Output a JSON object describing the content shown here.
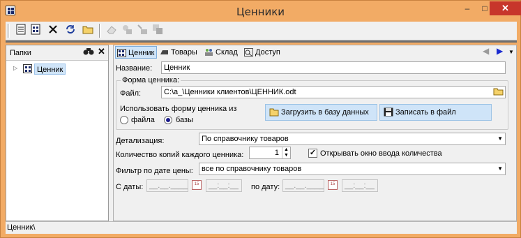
{
  "window": {
    "title": "Ценники",
    "minimize": "–",
    "maximize": "□",
    "close": "✕"
  },
  "toolbar": {
    "icons": [
      "doc-icon",
      "card-icon",
      "delete-icon",
      "refresh-icon",
      "folder-icon",
      "eraser-icon",
      "stamp-icon",
      "tools-icon",
      "copy-icon"
    ]
  },
  "left_panel": {
    "tab_label": "Папки",
    "tree": [
      {
        "label": "Ценник"
      }
    ]
  },
  "tabs": [
    {
      "label": "Ценник",
      "active": true
    },
    {
      "label": "Товары",
      "active": false
    },
    {
      "label": "Склад",
      "active": false
    },
    {
      "label": "Доступ",
      "active": false
    }
  ],
  "form": {
    "name_label": "Название:",
    "name_value": "Ценник",
    "group_title": "Форма ценника:",
    "file_label": "Файл:",
    "file_value": "C:\\a_\\Ценники клиентов\\ЦЕННИК.odt",
    "use_form_label": "Использовать форму ценника из",
    "radio_file_label": "файла",
    "radio_base_label": "базы",
    "radio_selected": "base",
    "load_button": "Загрузить в базу данных",
    "save_button": "Записать в файл",
    "detail_label": "Детализация:",
    "detail_value": "По справочнику товаров",
    "copies_label": "Количество копий каждого ценника:",
    "copies_value": "1",
    "open_qty_label": "Открывать окно ввода количества",
    "open_qty_checked": true,
    "check_mark": "✓",
    "filter_label": "Фильтр по дате цены:",
    "filter_value": "все по справочнику товаров",
    "from_label": "С даты:",
    "to_label": "по дату:",
    "date_placeholder": "__.__.____",
    "time_placeholder": "__:__:__"
  },
  "status": {
    "text": "Ценник\\"
  }
}
